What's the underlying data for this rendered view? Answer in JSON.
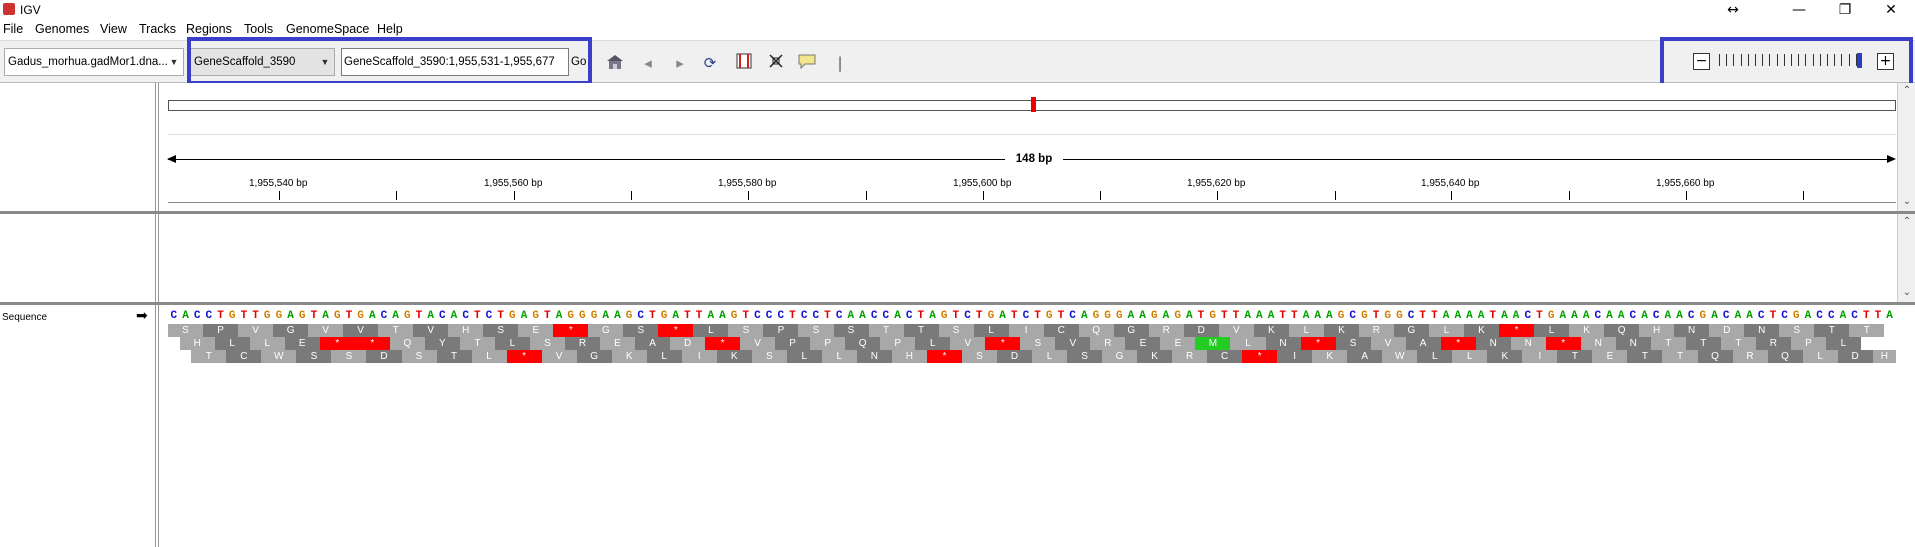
{
  "window": {
    "title": "IGV",
    "controls": [
      "↔",
      "—",
      "❐",
      "✕"
    ]
  },
  "menu": [
    "File",
    "Genomes",
    "View",
    "Tracks",
    "Regions",
    "Tools",
    "GenomeSpace",
    "Help"
  ],
  "toolbar": {
    "genome": "Gadus_morhua.gadMor1.dna...",
    "chromosome": "GeneScaffold_3590",
    "locus": "GeneScaffold_3590:1,955,531-1,955,677",
    "go_label": "Go"
  },
  "ruler": {
    "span_label": "148 bp",
    "ticks": [
      "1,955,540 bp",
      "1,955,560 bp",
      "1,955,580 bp",
      "1,955,600 bp",
      "1,955,620 bp",
      "1,955,640 bp",
      "1,955,660 bp"
    ]
  },
  "track": {
    "name": "Sequence",
    "strand_arrow": "➡"
  },
  "sequence": "CACCTGTTGGAGTAGTGACAGTACACTCTGAGTAGGGAAGCTGATTAAGTCCCTCCTCAACCACTAGTCTGATCTGTCAGGGAAGAGATGTTAAATTAAAGCGTGGCTTAAAATAACTGAAACAACACAACGACAACTCGACCACTTA",
  "frames": [
    "SPVGVVTVHSE*GS*LSPSSTTSLICQGRDVKLKRGLK*LKQHNDNSTT",
    "HLLE**QYTLSREAD*VPPQPLV*SVREEMLN*SVA*NN*NNTTTRPL",
    "TCWSSDSTL*VGKLIKSLLNH*SDLSGKRC*IKAWLLKITETTQRQLDHL"
  ],
  "colors": {
    "A": "#00a000",
    "C": "#1010d0",
    "G": "#d08000",
    "T": "#e00000",
    "stop": "#ff0000",
    "start": "#22cc22",
    "aa_dark": "#7a7a7a",
    "aa_light": "#a8a8a8",
    "highlight": "#3a3ec8"
  }
}
